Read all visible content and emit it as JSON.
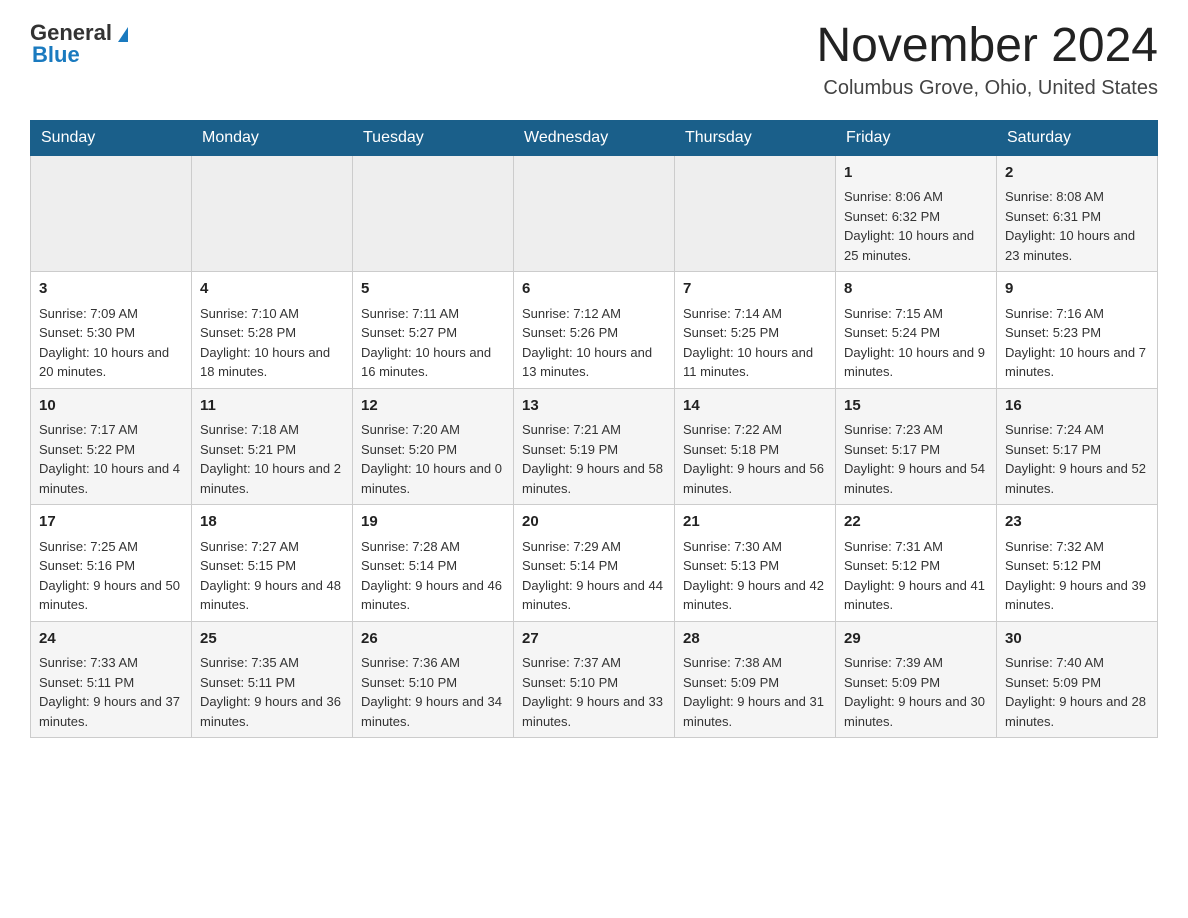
{
  "header": {
    "logo_general": "General",
    "logo_blue": "Blue",
    "month_title": "November 2024",
    "location": "Columbus Grove, Ohio, United States"
  },
  "days_of_week": [
    "Sunday",
    "Monday",
    "Tuesday",
    "Wednesday",
    "Thursday",
    "Friday",
    "Saturday"
  ],
  "weeks": [
    [
      {
        "day": "",
        "info": ""
      },
      {
        "day": "",
        "info": ""
      },
      {
        "day": "",
        "info": ""
      },
      {
        "day": "",
        "info": ""
      },
      {
        "day": "",
        "info": ""
      },
      {
        "day": "1",
        "info": "Sunrise: 8:06 AM\nSunset: 6:32 PM\nDaylight: 10 hours and 25 minutes."
      },
      {
        "day": "2",
        "info": "Sunrise: 8:08 AM\nSunset: 6:31 PM\nDaylight: 10 hours and 23 minutes."
      }
    ],
    [
      {
        "day": "3",
        "info": "Sunrise: 7:09 AM\nSunset: 5:30 PM\nDaylight: 10 hours and 20 minutes."
      },
      {
        "day": "4",
        "info": "Sunrise: 7:10 AM\nSunset: 5:28 PM\nDaylight: 10 hours and 18 minutes."
      },
      {
        "day": "5",
        "info": "Sunrise: 7:11 AM\nSunset: 5:27 PM\nDaylight: 10 hours and 16 minutes."
      },
      {
        "day": "6",
        "info": "Sunrise: 7:12 AM\nSunset: 5:26 PM\nDaylight: 10 hours and 13 minutes."
      },
      {
        "day": "7",
        "info": "Sunrise: 7:14 AM\nSunset: 5:25 PM\nDaylight: 10 hours and 11 minutes."
      },
      {
        "day": "8",
        "info": "Sunrise: 7:15 AM\nSunset: 5:24 PM\nDaylight: 10 hours and 9 minutes."
      },
      {
        "day": "9",
        "info": "Sunrise: 7:16 AM\nSunset: 5:23 PM\nDaylight: 10 hours and 7 minutes."
      }
    ],
    [
      {
        "day": "10",
        "info": "Sunrise: 7:17 AM\nSunset: 5:22 PM\nDaylight: 10 hours and 4 minutes."
      },
      {
        "day": "11",
        "info": "Sunrise: 7:18 AM\nSunset: 5:21 PM\nDaylight: 10 hours and 2 minutes."
      },
      {
        "day": "12",
        "info": "Sunrise: 7:20 AM\nSunset: 5:20 PM\nDaylight: 10 hours and 0 minutes."
      },
      {
        "day": "13",
        "info": "Sunrise: 7:21 AM\nSunset: 5:19 PM\nDaylight: 9 hours and 58 minutes."
      },
      {
        "day": "14",
        "info": "Sunrise: 7:22 AM\nSunset: 5:18 PM\nDaylight: 9 hours and 56 minutes."
      },
      {
        "day": "15",
        "info": "Sunrise: 7:23 AM\nSunset: 5:17 PM\nDaylight: 9 hours and 54 minutes."
      },
      {
        "day": "16",
        "info": "Sunrise: 7:24 AM\nSunset: 5:17 PM\nDaylight: 9 hours and 52 minutes."
      }
    ],
    [
      {
        "day": "17",
        "info": "Sunrise: 7:25 AM\nSunset: 5:16 PM\nDaylight: 9 hours and 50 minutes."
      },
      {
        "day": "18",
        "info": "Sunrise: 7:27 AM\nSunset: 5:15 PM\nDaylight: 9 hours and 48 minutes."
      },
      {
        "day": "19",
        "info": "Sunrise: 7:28 AM\nSunset: 5:14 PM\nDaylight: 9 hours and 46 minutes."
      },
      {
        "day": "20",
        "info": "Sunrise: 7:29 AM\nSunset: 5:14 PM\nDaylight: 9 hours and 44 minutes."
      },
      {
        "day": "21",
        "info": "Sunrise: 7:30 AM\nSunset: 5:13 PM\nDaylight: 9 hours and 42 minutes."
      },
      {
        "day": "22",
        "info": "Sunrise: 7:31 AM\nSunset: 5:12 PM\nDaylight: 9 hours and 41 minutes."
      },
      {
        "day": "23",
        "info": "Sunrise: 7:32 AM\nSunset: 5:12 PM\nDaylight: 9 hours and 39 minutes."
      }
    ],
    [
      {
        "day": "24",
        "info": "Sunrise: 7:33 AM\nSunset: 5:11 PM\nDaylight: 9 hours and 37 minutes."
      },
      {
        "day": "25",
        "info": "Sunrise: 7:35 AM\nSunset: 5:11 PM\nDaylight: 9 hours and 36 minutes."
      },
      {
        "day": "26",
        "info": "Sunrise: 7:36 AM\nSunset: 5:10 PM\nDaylight: 9 hours and 34 minutes."
      },
      {
        "day": "27",
        "info": "Sunrise: 7:37 AM\nSunset: 5:10 PM\nDaylight: 9 hours and 33 minutes."
      },
      {
        "day": "28",
        "info": "Sunrise: 7:38 AM\nSunset: 5:09 PM\nDaylight: 9 hours and 31 minutes."
      },
      {
        "day": "29",
        "info": "Sunrise: 7:39 AM\nSunset: 5:09 PM\nDaylight: 9 hours and 30 minutes."
      },
      {
        "day": "30",
        "info": "Sunrise: 7:40 AM\nSunset: 5:09 PM\nDaylight: 9 hours and 28 minutes."
      }
    ]
  ]
}
